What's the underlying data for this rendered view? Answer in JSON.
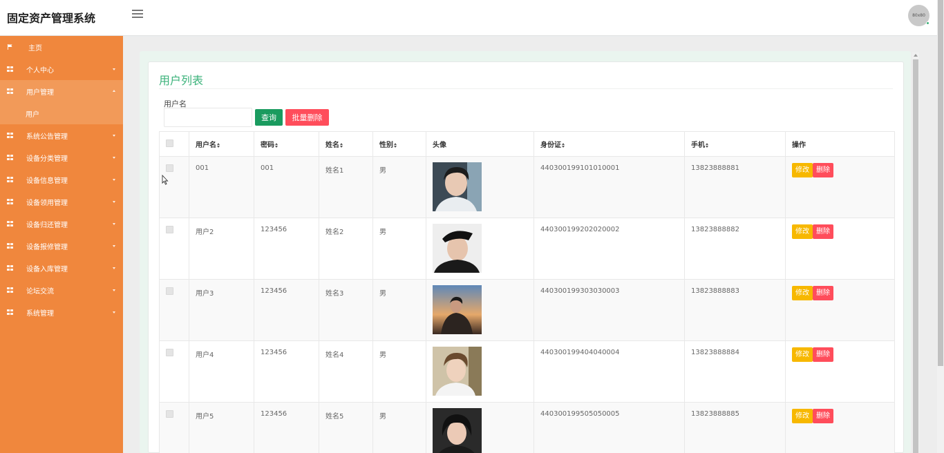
{
  "header": {
    "brand": "固定资产管理系统",
    "avatar_text": "80x80"
  },
  "sidebar": {
    "items": [
      {
        "label": "主页",
        "icon": "flag-icon"
      },
      {
        "label": "个人中心",
        "icon": "grid-icon"
      },
      {
        "label": "用户管理",
        "icon": "grid-icon",
        "active": true
      },
      {
        "label": "用户",
        "sub": true
      },
      {
        "label": "系统公告管理",
        "icon": "grid-icon"
      },
      {
        "label": "设备分类管理",
        "icon": "grid-icon"
      },
      {
        "label": "设备信息管理",
        "icon": "grid-icon"
      },
      {
        "label": "设备领用管理",
        "icon": "grid-icon"
      },
      {
        "label": "设备归还管理",
        "icon": "grid-icon"
      },
      {
        "label": "设备报修管理",
        "icon": "grid-icon"
      },
      {
        "label": "设备入库管理",
        "icon": "grid-icon"
      },
      {
        "label": "论坛交流",
        "icon": "grid-icon"
      },
      {
        "label": "系统管理",
        "icon": "grid-icon"
      }
    ]
  },
  "main": {
    "title": "用户列表",
    "search": {
      "label": "用户名",
      "value": "",
      "placeholder": ""
    },
    "buttons": {
      "query": "查询",
      "bulk_delete": "批量删除"
    },
    "table": {
      "columns": [
        "用户名",
        "密码",
        "姓名",
        "性别",
        "头像",
        "身份证",
        "手机",
        "操作"
      ],
      "rows": [
        {
          "username": "001",
          "password": "001",
          "name": "姓名1",
          "gender": "男",
          "id_card": "440300199101010001",
          "phone": "13823888881"
        },
        {
          "username": "用户2",
          "password": "123456",
          "name": "姓名2",
          "gender": "男",
          "id_card": "440300199202020002",
          "phone": "13823888882"
        },
        {
          "username": "用户3",
          "password": "123456",
          "name": "姓名3",
          "gender": "男",
          "id_card": "440300199303030003",
          "phone": "13823888883"
        },
        {
          "username": "用户4",
          "password": "123456",
          "name": "姓名4",
          "gender": "男",
          "id_card": "440300199404040004",
          "phone": "13823888884"
        },
        {
          "username": "用户5",
          "password": "123456",
          "name": "姓名5",
          "gender": "男",
          "id_card": "440300199505050005",
          "phone": "13823888885"
        }
      ],
      "actions": {
        "edit": "修改",
        "delete": "删除"
      }
    }
  },
  "colors": {
    "sidebar": "#f0873d",
    "sidebar_active": "#f29a59",
    "title_green": "#3bb27a",
    "query_button": "#1a9b5f",
    "delete_button": "#ff4d5b",
    "edit_button": "#f7b800"
  }
}
